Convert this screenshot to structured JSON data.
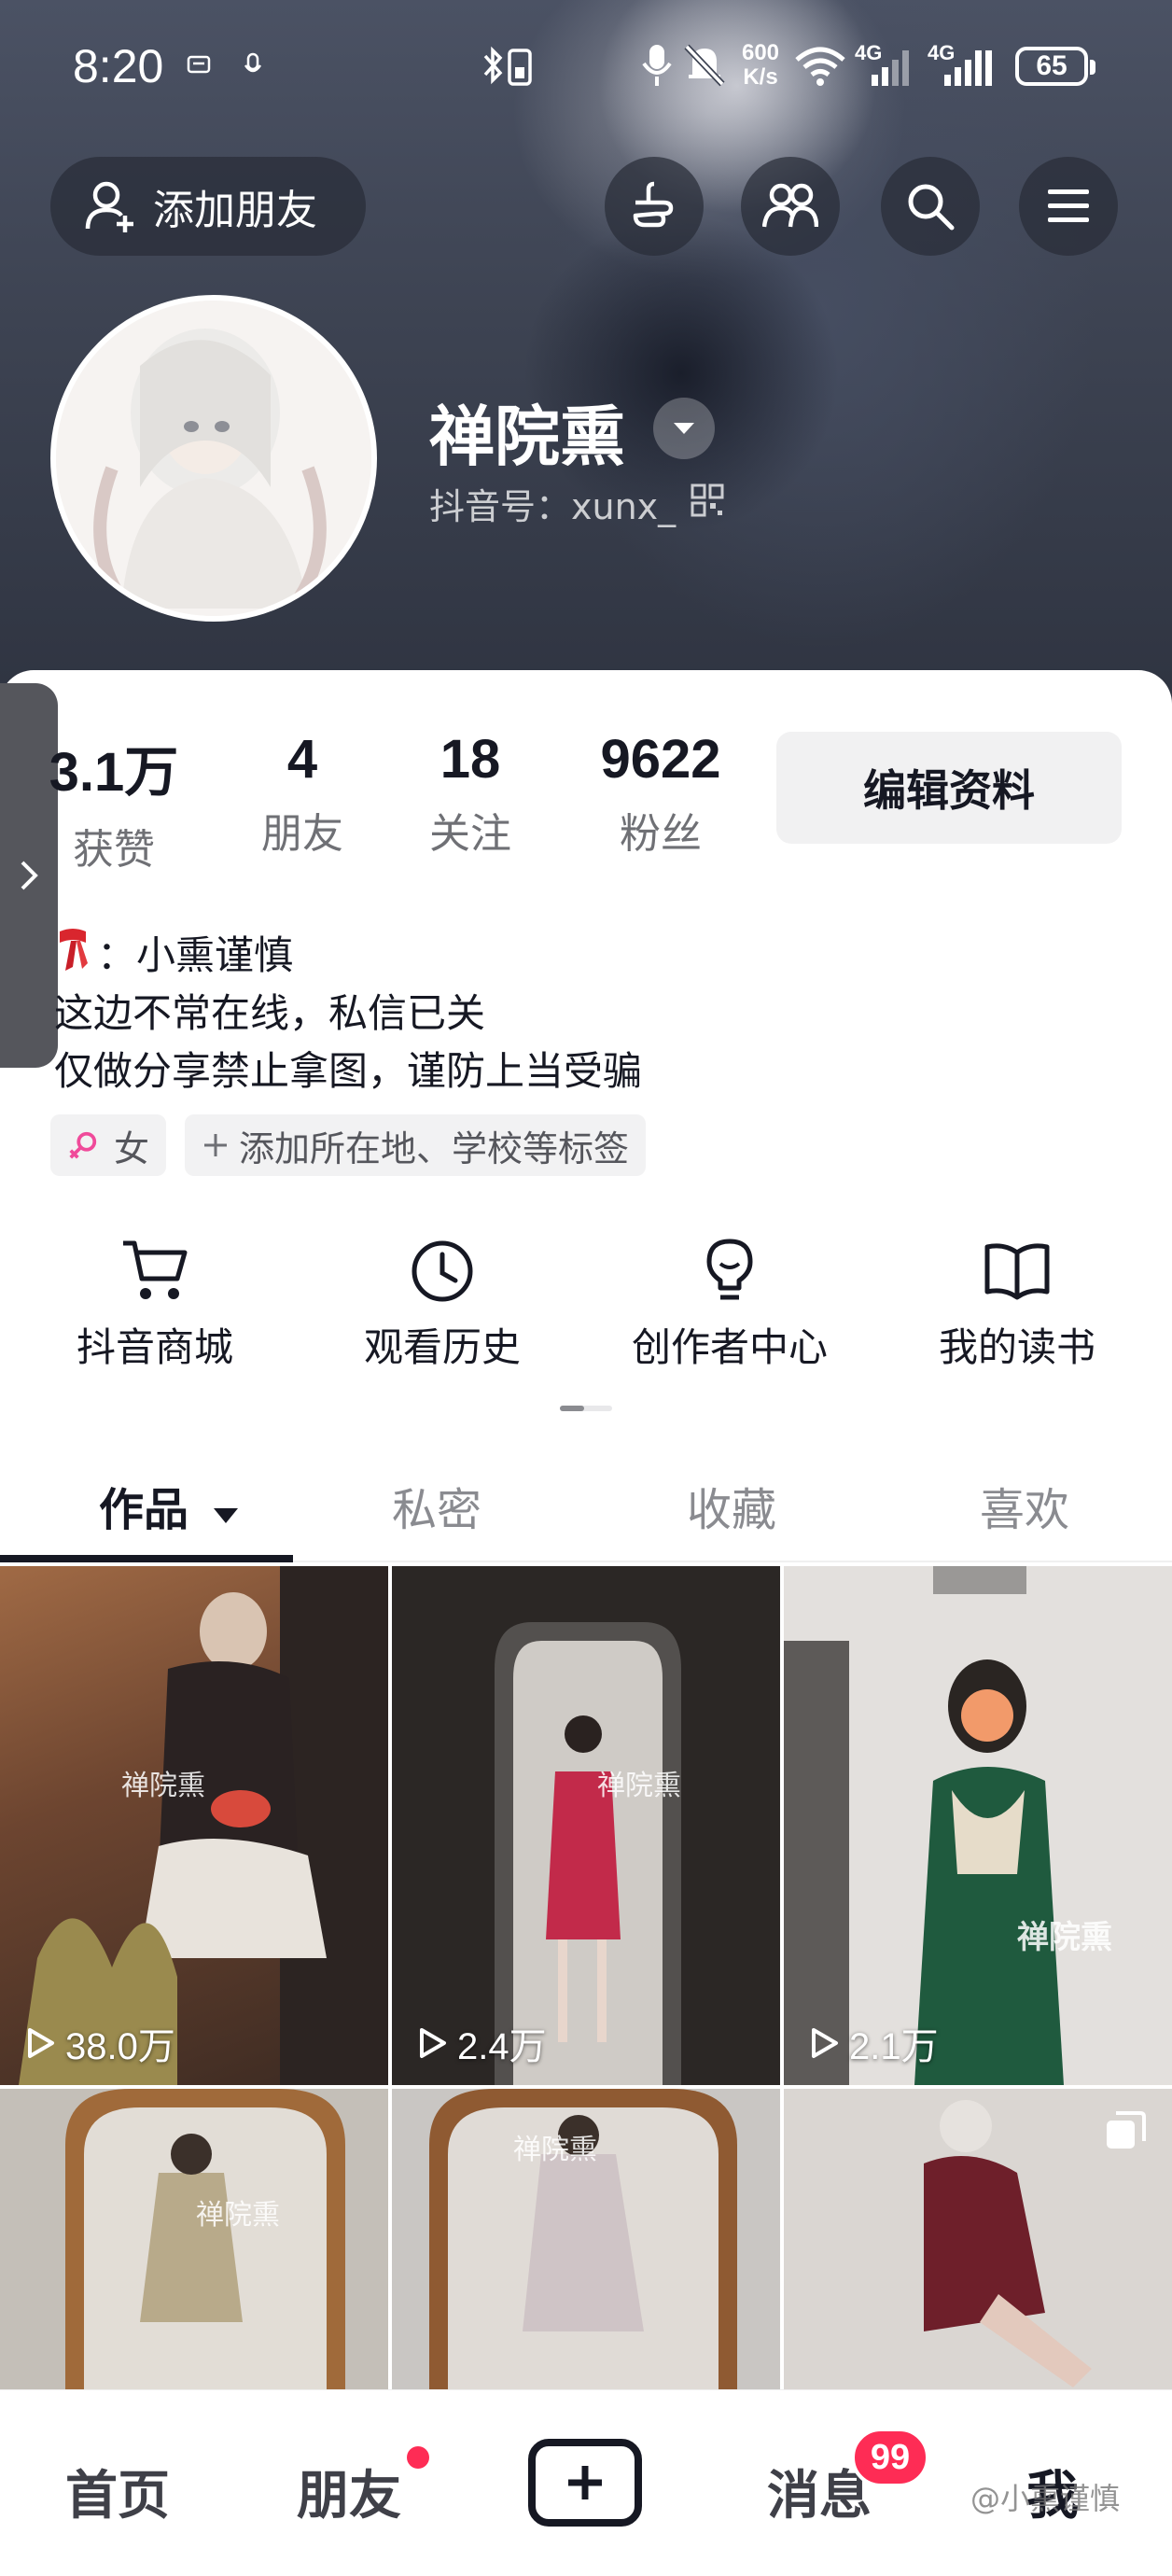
{
  "status_bar": {
    "time": "8:20",
    "net_speed": "600\nK/s",
    "net_speed_top": "600",
    "net_speed_bottom": "K/s",
    "signal1": "4G",
    "signal2": "4G",
    "battery": "65"
  },
  "header": {
    "add_friend_label": "添加朋友",
    "nickname": "禅院熏",
    "douyin_id": "抖音号：xunx_"
  },
  "stats": [
    {
      "value": "3.1万",
      "label": "获赞"
    },
    {
      "value": "4",
      "label": "朋友"
    },
    {
      "value": "18",
      "label": "关注"
    },
    {
      "value": "9622",
      "label": "粉丝"
    }
  ],
  "edit_profile_label": "编辑资料",
  "bio": {
    "line1": "：小熏谨慎",
    "line2": "这边不常在线，私信已关",
    "line3": "仅做分享禁止拿图，谨防上当受骗"
  },
  "tags": {
    "gender": "女",
    "add_location": "添加所在地、学校等标签"
  },
  "tools": [
    {
      "label": "抖音商城",
      "icon": "cart-icon"
    },
    {
      "label": "观看历史",
      "icon": "clock-icon"
    },
    {
      "label": "创作者中心",
      "icon": "lightbulb-icon"
    },
    {
      "label": "我的读书",
      "icon": "book-icon"
    }
  ],
  "tabs": [
    {
      "label": "作品",
      "active": true
    },
    {
      "label": "私密",
      "active": false
    },
    {
      "label": "收藏",
      "active": false
    },
    {
      "label": "喜欢",
      "active": false
    }
  ],
  "videos": [
    {
      "plays": "38.0万",
      "watermark": "禅院熏"
    },
    {
      "plays": "2.4万",
      "watermark": "禅院熏"
    },
    {
      "plays": "2.1万",
      "watermark": "禅院熏"
    },
    {
      "plays": "",
      "watermark": "禅院熏"
    },
    {
      "plays": "",
      "watermark": "禅院熏"
    },
    {
      "plays": "",
      "watermark": ""
    }
  ],
  "bottom_nav": {
    "home": "首页",
    "friends": "朋友",
    "messages": "消息",
    "messages_badge": "99",
    "me": "我"
  },
  "watermark": "@小熏谨慎",
  "colors": {
    "accent_red": "#fe2c55",
    "text_primary": "#161823",
    "text_secondary": "#6f7075"
  }
}
